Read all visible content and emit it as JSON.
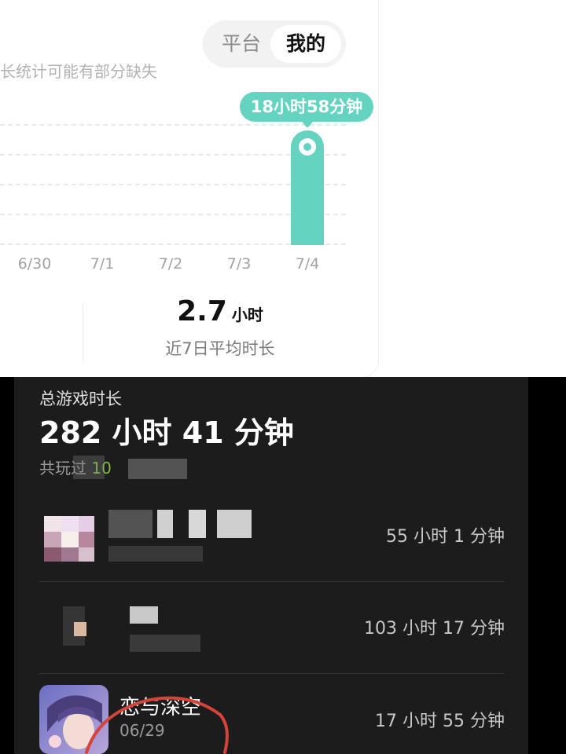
{
  "top_card": {
    "toggle": {
      "left": "平台",
      "right": "我的"
    },
    "subtitle": "长统计可能有部分缺失",
    "tooltip": "18小时58分钟",
    "summary": {
      "value": "2.7",
      "unit": "小时",
      "label": "近7日平均时长"
    }
  },
  "chart_data": {
    "type": "bar",
    "categories": [
      "6/30",
      "7/1",
      "7/2",
      "7/3",
      "7/4"
    ],
    "values": [
      0,
      0,
      0,
      0,
      18.97
    ],
    "ylabel": "",
    "highlight": {
      "category": "7/4",
      "label": "18小时58分钟"
    },
    "grid": true
  },
  "dark_panel": {
    "total_label": "总游戏时长",
    "total_value": "282 小时 41 分钟",
    "played_prefix": "共玩过",
    "played_count": "10",
    "games": [
      {
        "name": "",
        "date": "",
        "time": "55 小时 1 分钟"
      },
      {
        "name": "",
        "date": "",
        "time": "103 小时 17 分钟"
      },
      {
        "name": "恋与深空",
        "date": "06/29",
        "time": "17 小时 55 分钟"
      }
    ]
  }
}
